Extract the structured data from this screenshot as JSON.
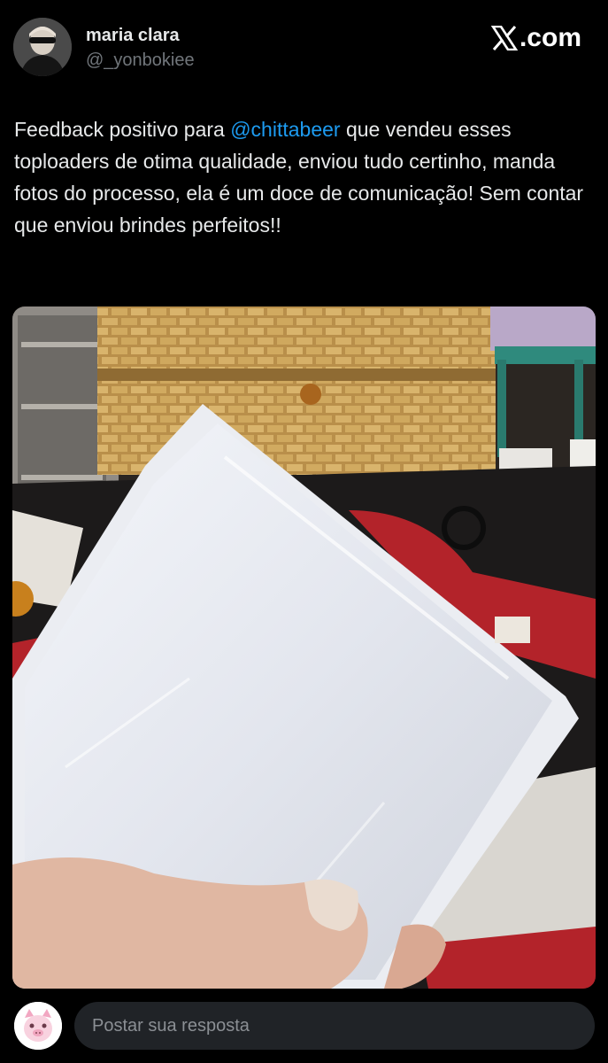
{
  "author": {
    "name": "maria clara",
    "handle": "@_yonbokiee",
    "avatar_icon": "profile-avatar-icon"
  },
  "brand": {
    "logo_icon": "x-logo-icon",
    "text": ".com"
  },
  "tweet": {
    "text_before": "Feedback positivo para ",
    "mention": "@chittabeer",
    "text_after": " que vendeu esses toploaders de otima qualidade, enviou tudo certinho, manda fotos do processo, ela é um doce de comunicação! Sem contar que enviou brindes perfeitos!!",
    "mention_color": "#1d9bf0"
  },
  "media": {
    "icon": "photo-toploader-icon"
  },
  "reply": {
    "placeholder": "Postar sua resposta",
    "avatar_icon": "pig-avatar-icon"
  }
}
